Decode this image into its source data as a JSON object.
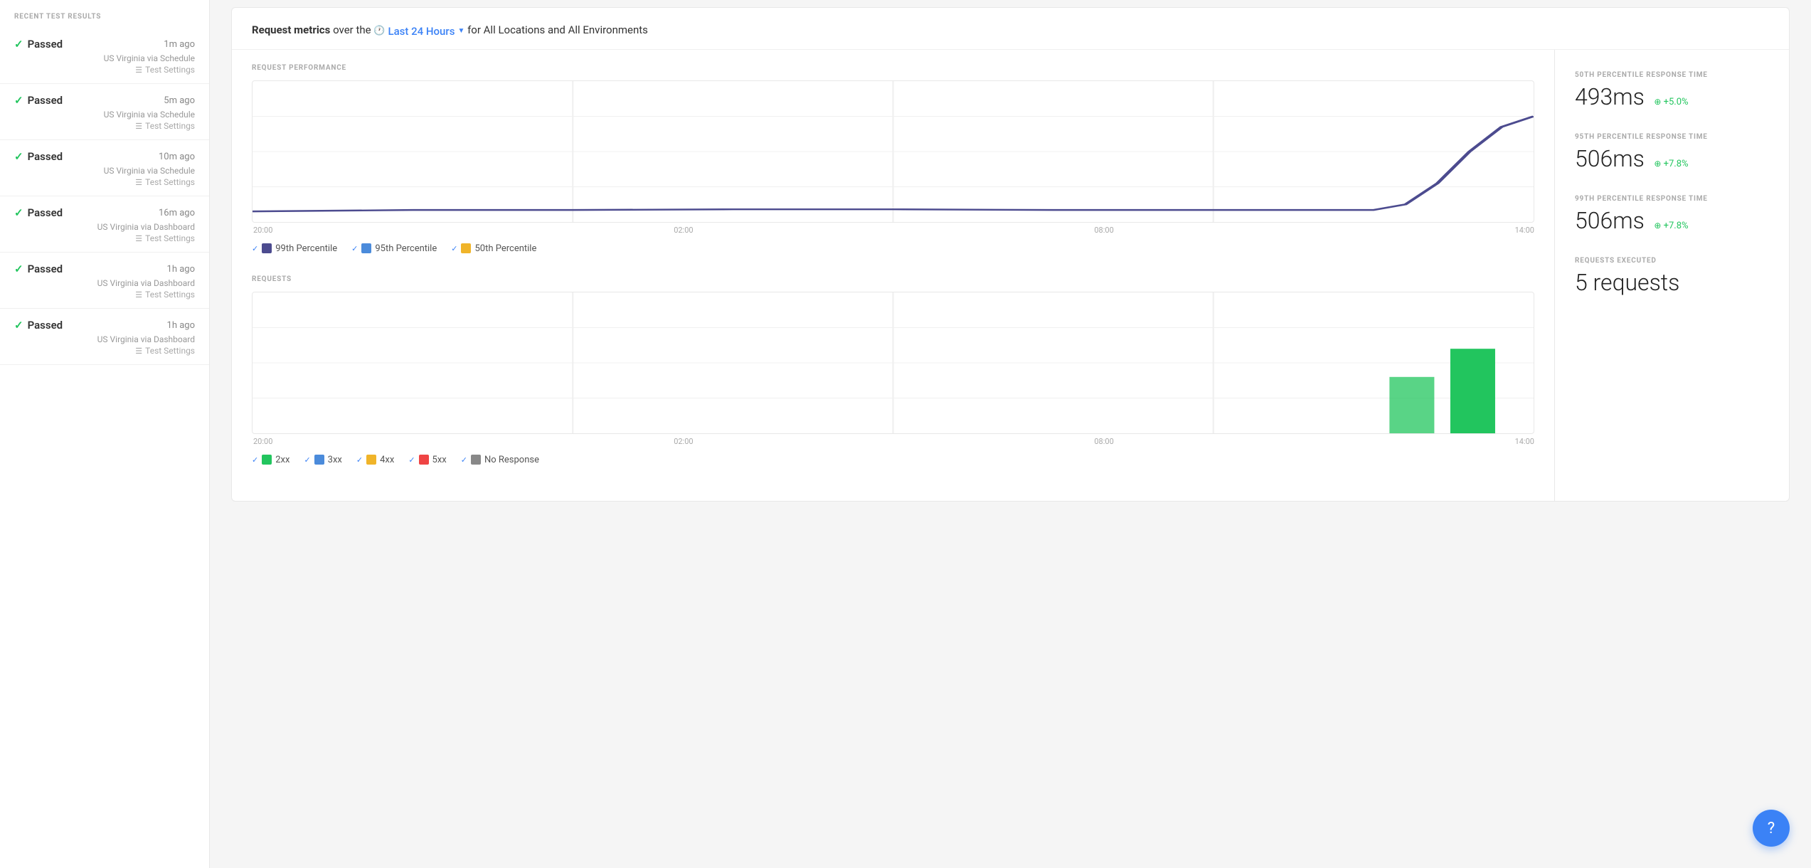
{
  "sidebar": {
    "header": "Recent Test Results",
    "results": [
      {
        "status": "Passed",
        "time": "1m ago",
        "location": "US Virginia via Schedule",
        "settings": "Test Settings"
      },
      {
        "status": "Passed",
        "time": "5m ago",
        "location": "US Virginia via Schedule",
        "settings": "Test Settings"
      },
      {
        "status": "Passed",
        "time": "10m ago",
        "location": "US Virginia via Schedule",
        "settings": "Test Settings"
      },
      {
        "status": "Passed",
        "time": "16m ago",
        "location": "US Virginia via Dashboard",
        "settings": "Test Settings"
      },
      {
        "status": "Passed",
        "time": "1h ago",
        "location": "US Virginia via Dashboard",
        "settings": "Test Settings"
      },
      {
        "status": "Passed",
        "time": "1h ago",
        "location": "US Virginia via Dashboard",
        "settings": "Test Settings"
      }
    ]
  },
  "metrics": {
    "header_prefix": "Request metrics",
    "header_over": "over the",
    "time_period": "Last 24 Hours",
    "header_suffix": "for All Locations and All Environments",
    "performance_chart": {
      "title": "REQUEST PERFORMANCE",
      "x_labels": [
        "20:00",
        "02:00",
        "08:00",
        "14:00"
      ],
      "legend": [
        {
          "label": "99th Percentile",
          "color": "#4c4b8f"
        },
        {
          "label": "95th Percentile",
          "color": "#4b8bdb"
        },
        {
          "label": "50th Percentile",
          "color": "#f0b429"
        }
      ]
    },
    "requests_chart": {
      "title": "REQUESTS",
      "x_labels": [
        "20:00",
        "02:00",
        "08:00",
        "14:00"
      ],
      "legend": [
        {
          "label": "2xx",
          "color": "#22c55e"
        },
        {
          "label": "3xx",
          "color": "#4b8bdb"
        },
        {
          "label": "4xx",
          "color": "#f0b429"
        },
        {
          "label": "5xx",
          "color": "#ef4444"
        },
        {
          "label": "No Response",
          "color": "#888"
        }
      ]
    }
  },
  "stats": {
    "p50_label": "50TH PERCENTILE RESPONSE TIME",
    "p50_value": "493ms",
    "p50_change": "+5.0%",
    "p95_label": "95TH PERCENTILE RESPONSE TIME",
    "p95_value": "506ms",
    "p95_change": "+7.8%",
    "p99_label": "99TH PERCENTILE RESPONSE TIME",
    "p99_value": "506ms",
    "p99_change": "+7.8%",
    "executed_label": "REQUESTS EXECUTED",
    "executed_value": "5 requests"
  },
  "chat_button": "?"
}
